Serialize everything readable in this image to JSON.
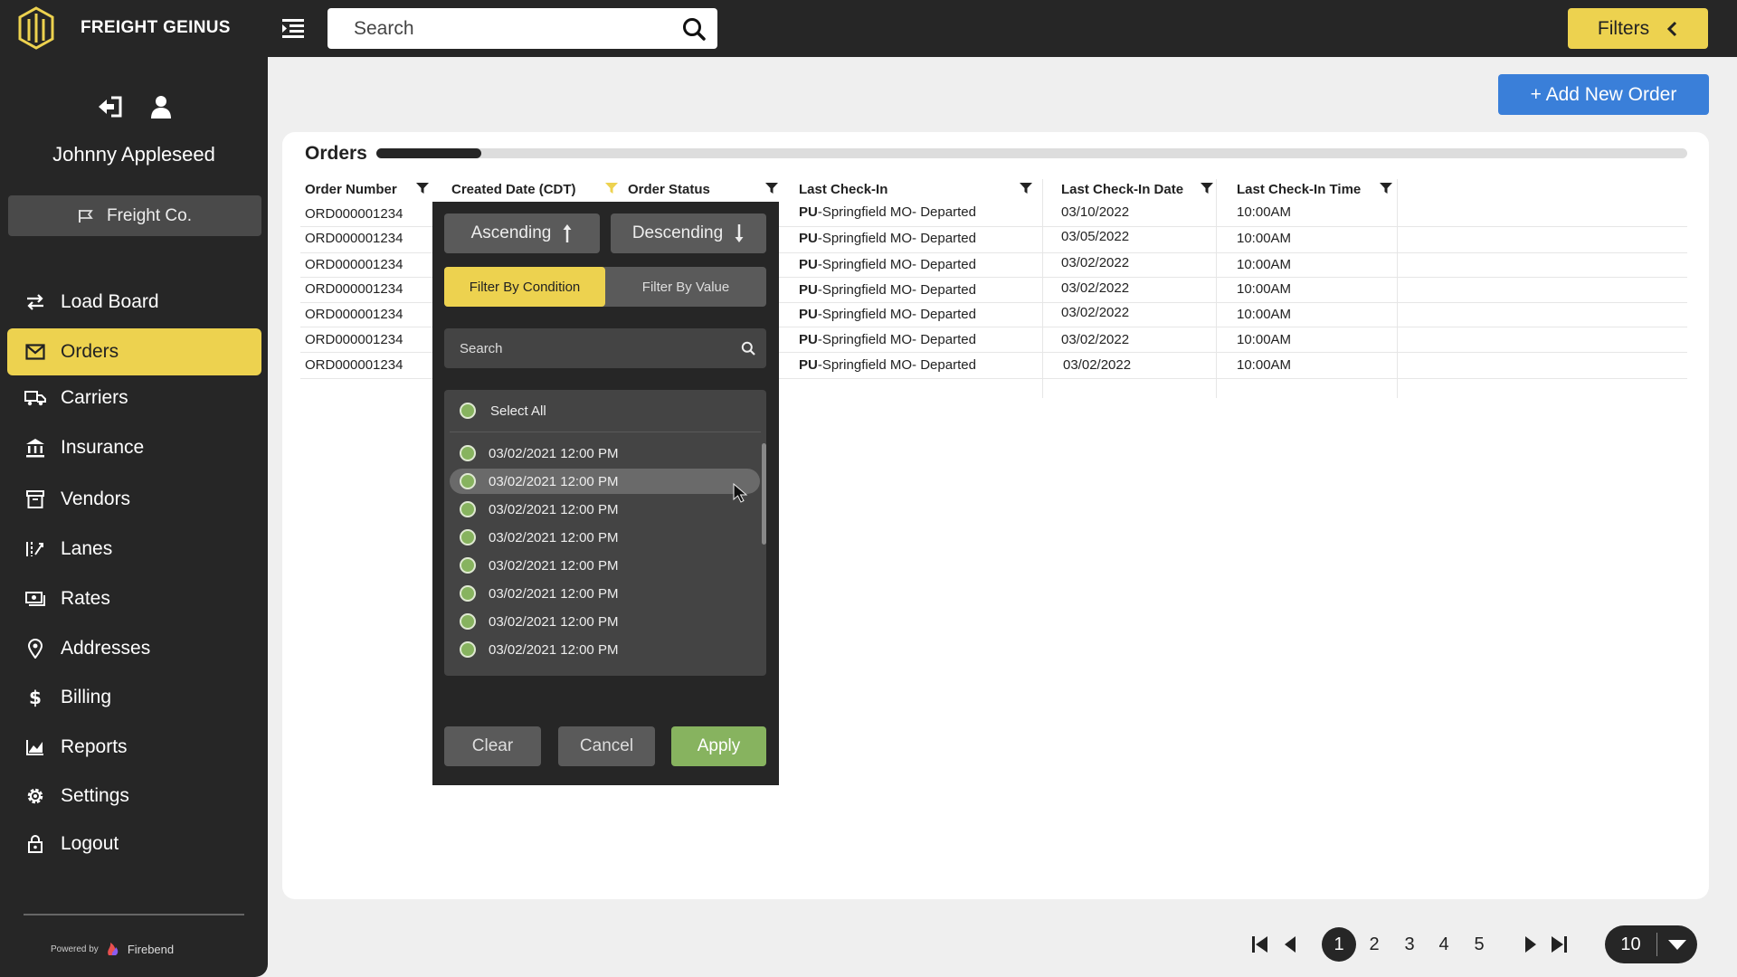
{
  "app": {
    "brand": "FREIGHT GEINUS",
    "search_placeholder": "Search",
    "filters_label": "Filters"
  },
  "sidebar": {
    "user_name": "Johnny Appleseed",
    "company": "Freight Co.",
    "items": [
      {
        "label": "Load Board",
        "icon": "arrows-swap-icon"
      },
      {
        "label": "Orders",
        "icon": "envelope-icon",
        "active": true
      },
      {
        "label": "Carriers",
        "icon": "truck-icon"
      },
      {
        "label": "Insurance",
        "icon": "bank-icon"
      },
      {
        "label": "Vendors",
        "icon": "archive-box-icon"
      },
      {
        "label": "Lanes",
        "icon": "lanes-icon"
      },
      {
        "label": "Rates",
        "icon": "money-icon"
      },
      {
        "label": "Addresses",
        "icon": "map-pin-icon"
      },
      {
        "label": "Billing",
        "icon": "dollar-icon"
      },
      {
        "label": "Reports",
        "icon": "chart-icon"
      },
      {
        "label": "Settings",
        "icon": "gear-icon"
      },
      {
        "label": "Logout",
        "icon": "lock-icon"
      }
    ],
    "powered_by": "Powered by",
    "powered_brand": "Firebend"
  },
  "main": {
    "add_order_label": "+ Add New Order",
    "orders_title": "Orders",
    "progress": 0.08,
    "columns": [
      "Order Number",
      "Created Date (CDT)",
      "Order Status",
      "Last Check-In",
      "Last Check-In Date",
      "Last Check-In Time"
    ],
    "rows": [
      {
        "order": "ORD000001234",
        "checkin_prefix": "PU",
        "checkin": "-Springfield MO- Departed",
        "date": "03/10/2022",
        "time": "10:00AM"
      },
      {
        "order": "ORD000001234",
        "checkin_prefix": "PU",
        "checkin": "-Springfield MO- Departed",
        "date": "03/05/2022",
        "time": "10:00AM"
      },
      {
        "order": "ORD000001234",
        "checkin_prefix": "PU",
        "checkin": "-Springfield MO- Departed",
        "date": "03/02/2022",
        "time": "10:00AM"
      },
      {
        "order": "ORD000001234",
        "checkin_prefix": "PU",
        "checkin": "-Springfield MO- Departed",
        "date": "03/02/2022",
        "time": "10:00AM"
      },
      {
        "order": "ORD000001234",
        "checkin_prefix": "PU",
        "checkin": "-Springfield MO- Departed",
        "date": "03/02/2022",
        "time": "10:00AM"
      },
      {
        "order": "ORD000001234",
        "checkin_prefix": "PU",
        "checkin": "-Springfield MO- Departed",
        "date": "03/02/2022",
        "time": "10:00AM"
      },
      {
        "order": "ORD000001234",
        "checkin_prefix": "PU",
        "checkin": "-Springfield MO- Departed",
        "date": "03/02/2022",
        "time": "10:00AM"
      }
    ]
  },
  "filter_popup": {
    "ascending": "Ascending",
    "descending": "Descending",
    "filter_by_condition": "Filter By Condition",
    "filter_by_value": "Filter By Value",
    "search_placeholder": "Search",
    "select_all": "Select All",
    "options": [
      "03/02/2021 12:00 PM",
      "03/02/2021 12:00 PM",
      "03/02/2021 12:00 PM",
      "03/02/2021 12:00 PM",
      "03/02/2021 12:00 PM",
      "03/02/2021 12:00 PM",
      "03/02/2021 12:00 PM",
      "03/02/2021 12:00 PM"
    ],
    "clear": "Clear",
    "cancel": "Cancel",
    "apply": "Apply"
  },
  "pagination": {
    "pages": [
      "1",
      "2",
      "3",
      "4",
      "5"
    ],
    "current": "1",
    "per_page": "10"
  },
  "colors": {
    "accent_yellow": "#edd24f",
    "primary_blue": "#3a7fd9",
    "apply_green": "#87b35f",
    "dark": "#262626"
  }
}
